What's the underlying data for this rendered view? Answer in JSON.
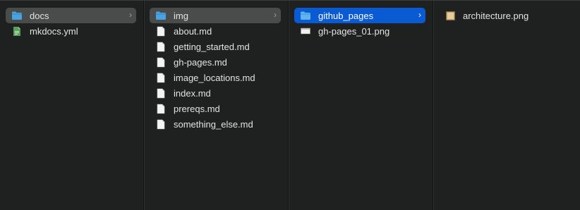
{
  "columns": [
    {
      "items": [
        {
          "label": "docs",
          "icon": "folder-icon",
          "chevron": "›"
        },
        {
          "label": "mkdocs.yml",
          "icon": "yaml-file-icon"
        }
      ]
    },
    {
      "items": [
        {
          "label": "img",
          "icon": "folder-icon",
          "chevron": "›"
        },
        {
          "label": "about.md",
          "icon": "document-icon"
        },
        {
          "label": "getting_started.md",
          "icon": "document-icon"
        },
        {
          "label": "gh-pages.md",
          "icon": "document-icon"
        },
        {
          "label": "image_locations.md",
          "icon": "document-icon"
        },
        {
          "label": "index.md",
          "icon": "document-icon"
        },
        {
          "label": "prereqs.md",
          "icon": "document-icon"
        },
        {
          "label": "something_else.md",
          "icon": "document-icon"
        }
      ]
    },
    {
      "items": [
        {
          "label": "github_pages",
          "icon": "folder-icon",
          "chevron": "›"
        },
        {
          "label": "gh-pages_01.png",
          "icon": "image-file-icon"
        }
      ]
    },
    {
      "items": [
        {
          "label": "architecture.png",
          "icon": "image-file-icon"
        }
      ]
    }
  ],
  "colors": {
    "selection_gray": "#4a4b4b",
    "selection_blue": "#0a5ad4",
    "folder_blue": "#4aa3e0"
  }
}
